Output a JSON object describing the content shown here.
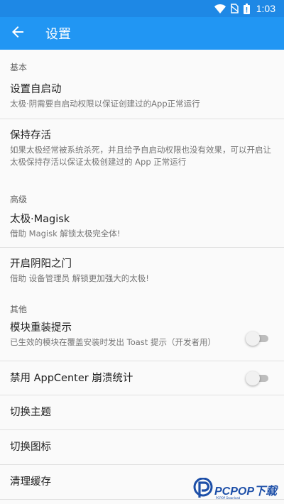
{
  "status_bar": {
    "time": "1:03"
  },
  "app_bar": {
    "title": "设置",
    "back_icon": "arrow-back-icon"
  },
  "sections": {
    "basic": {
      "header": "基本",
      "autostart": {
        "title": "设置自启动",
        "subtitle": "太极·阴需要自启动权限以保证创建过的App正常运行"
      },
      "keepalive": {
        "title": "保持存活",
        "subtitle": "如果太极经常被系统杀死，并且给予自启动权限也没有效果，可以开启让太极保持存活以保证太极创建过的 App 正常运行"
      }
    },
    "advanced": {
      "header": "高级",
      "magisk": {
        "title": "太极·Magisk",
        "subtitle": "借助 Magisk 解锁太极完全体!"
      },
      "yinyang": {
        "title": "开启阴阳之门",
        "subtitle": "借助 设备管理员 解锁更加强大的太极!"
      }
    },
    "other": {
      "header": "其他",
      "reinstall_hint": {
        "title": "模块重装提示",
        "subtitle": "已生效的模块在覆盖安装时发出 Toast 提示（开发者用）",
        "enabled": false
      },
      "appcenter": {
        "title": "禁用 AppCenter 崩溃统计",
        "enabled": false
      },
      "switch_theme": {
        "title": "切换主题"
      },
      "switch_icon": {
        "title": "切换图标"
      },
      "clear_cache": {
        "title": "清理缓存"
      }
    }
  },
  "watermark": {
    "text": "PCPOP下载",
    "subtext": "PCPOP Download"
  },
  "colors": {
    "primary": "#2196f3",
    "status_bar": "#1e88e5",
    "watermark": "#1d4fa8"
  }
}
